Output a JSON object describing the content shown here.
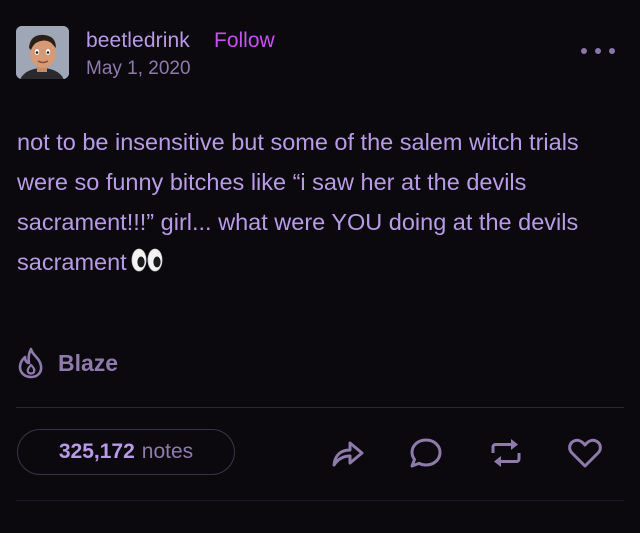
{
  "post": {
    "author": "beetledrink",
    "follow_label": "Follow",
    "date": "May 1, 2020",
    "text": "not to be insensitive but some of the salem witch trials were so funny bitches like “i saw her at the devils sacrament!!!” girl... what were YOU doing at the devils sacrament",
    "emoji": "eyes"
  },
  "actions": {
    "blaze_label": "Blaze",
    "notes_count": "325,172",
    "notes_label": "notes",
    "icons": [
      "share-icon",
      "reply-icon",
      "reblog-icon",
      "like-icon"
    ]
  },
  "colors": {
    "background": "#0b090e",
    "text": "#b79be6",
    "accent": "#c94ff0",
    "muted": "#8e7bab"
  }
}
